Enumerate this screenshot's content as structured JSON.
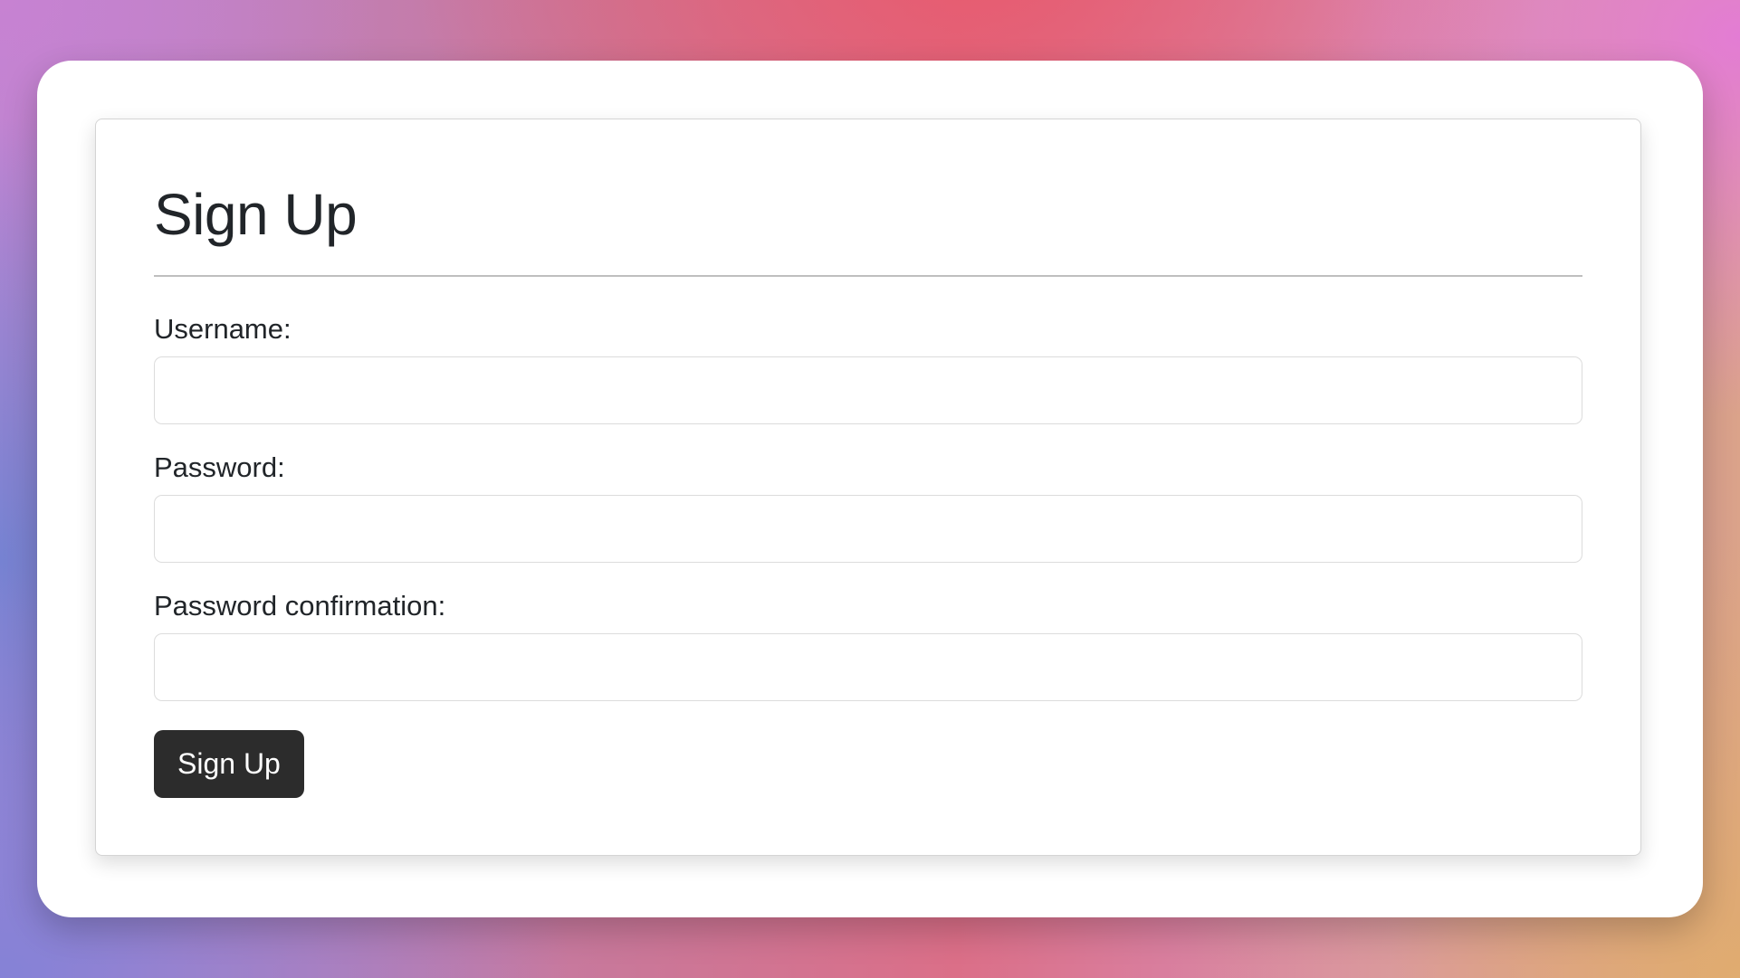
{
  "form": {
    "title": "Sign Up",
    "fields": [
      {
        "label": "Username:",
        "value": "",
        "placeholder": ""
      },
      {
        "label": "Password:",
        "value": "",
        "placeholder": ""
      },
      {
        "label": "Password confirmation:",
        "value": "",
        "placeholder": ""
      }
    ],
    "submit_label": "Sign Up"
  },
  "colors": {
    "button_background": "#2c2c2c",
    "button_text": "#ffffff",
    "text": "#212529",
    "card_border": "#d4d4d4"
  }
}
